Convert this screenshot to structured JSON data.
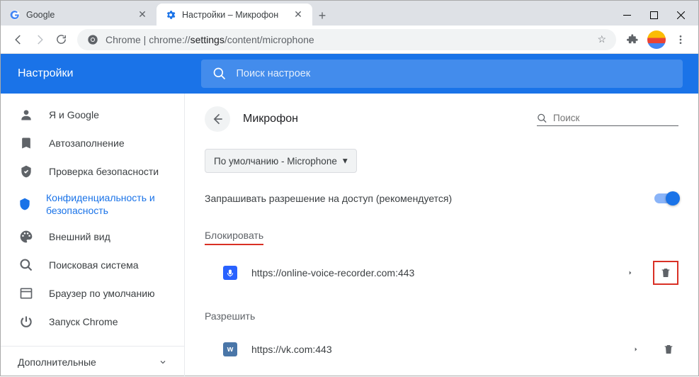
{
  "window": {
    "tabs": [
      {
        "title": "Google",
        "active": false
      },
      {
        "title": "Настройки – Микрофон",
        "active": true
      }
    ]
  },
  "addressbar": {
    "prefix": "Chrome",
    "sep": " | ",
    "url_dim": "chrome://",
    "url_main": "settings",
    "url_tail": "/content/microphone"
  },
  "settings_title": "Настройки",
  "search_placeholder": "Поиск настроек",
  "sidebar": {
    "items": [
      {
        "label": "Я и Google"
      },
      {
        "label": "Автозаполнение"
      },
      {
        "label": "Проверка безопасности"
      },
      {
        "label": "Конфиденциальность и безопасность"
      },
      {
        "label": "Внешний вид"
      },
      {
        "label": "Поисковая система"
      },
      {
        "label": "Браузер по умолчанию"
      },
      {
        "label": "Запуск Chrome"
      }
    ],
    "bottom": "Дополнительные"
  },
  "content": {
    "page_title": "Микрофон",
    "mini_search_placeholder": "Поиск",
    "dropdown": "По умолчанию - Microphone",
    "toggle_label": "Запрашивать разрешение на доступ (рекомендуется)",
    "toggle_on": true,
    "block_label": "Блокировать",
    "allow_label": "Разрешить",
    "blocked": [
      {
        "url": "https://online-voice-recorder.com:443",
        "icon": "ovr"
      }
    ],
    "allowed": [
      {
        "url": "https://vk.com:443",
        "icon": "vk",
        "icon_text": "w"
      }
    ]
  }
}
